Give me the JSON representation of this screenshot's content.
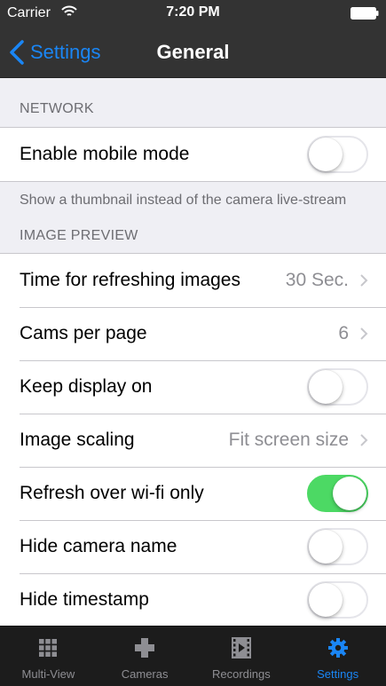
{
  "status_bar": {
    "carrier": "Carrier",
    "time": "7:20 PM",
    "wifi_icon": "wifi-icon",
    "battery_icon": "battery-icon"
  },
  "nav": {
    "back_label": "Settings",
    "title": "General",
    "accent_color": "#1a86f5"
  },
  "sections": {
    "network": {
      "header": "NETWORK",
      "rows": [
        {
          "label": "Enable mobile mode",
          "type": "switch",
          "on": false
        }
      ],
      "footer": "Show a thumbnail instead of the camera live-stream"
    },
    "image_preview": {
      "header": "IMAGE PREVIEW",
      "rows": [
        {
          "label": "Time for refreshing images",
          "type": "detail",
          "value": "30 Sec."
        },
        {
          "label": "Cams per page",
          "type": "detail",
          "value": "6"
        },
        {
          "label": "Keep display on",
          "type": "switch",
          "on": false
        },
        {
          "label": "Image scaling",
          "type": "detail",
          "value": "Fit screen size"
        },
        {
          "label": "Refresh over wi-fi only",
          "type": "switch",
          "on": true
        },
        {
          "label": "Hide camera name",
          "type": "switch",
          "on": false
        },
        {
          "label": "Hide timestamp",
          "type": "switch",
          "on": false
        }
      ]
    }
  },
  "tabs": [
    {
      "label": "Multi-View",
      "icon": "grid-icon",
      "active": false
    },
    {
      "label": "Cameras",
      "icon": "plus-icon",
      "active": false
    },
    {
      "label": "Recordings",
      "icon": "film-icon",
      "active": false
    },
    {
      "label": "Settings",
      "icon": "gear-icon",
      "active": true
    }
  ],
  "colors": {
    "switch_on": "#4cd964",
    "active_tab": "#1a86f5",
    "bar_background": "#333333"
  }
}
